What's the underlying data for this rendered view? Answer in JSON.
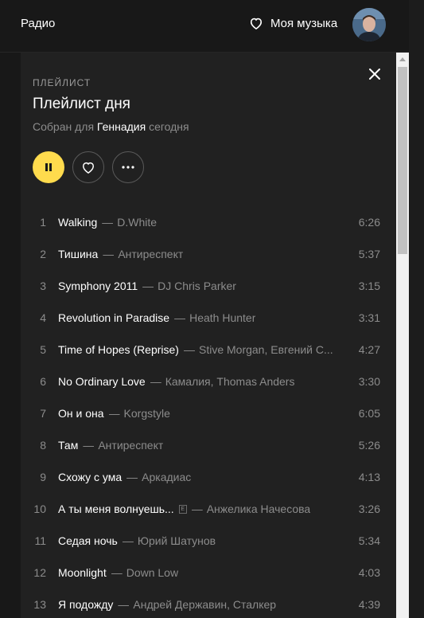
{
  "topbar": {
    "radio_label": "Радио",
    "my_music_label": "Моя музыка"
  },
  "playlist": {
    "kind": "ПЛЕЙЛИСТ",
    "title": "Плейлист дня",
    "subtitle_prefix": "Собран для",
    "subtitle_user": "Геннадия",
    "subtitle_suffix": "сегодня"
  },
  "colors": {
    "accent": "#ffdb4d",
    "background": "#181818",
    "panel": "#212121"
  },
  "controls": {
    "play_icon": "pause-icon",
    "like_icon": "heart-icon",
    "more_icon": "more-icon"
  },
  "tracks": [
    {
      "num": "1",
      "title": "Walking",
      "artist": "D.White",
      "duration": "6:26",
      "explicit": false
    },
    {
      "num": "2",
      "title": "Тишина",
      "artist": "Антиреспект",
      "duration": "5:37",
      "explicit": false
    },
    {
      "num": "3",
      "title": "Symphony 2011",
      "artist": "DJ Chris Parker",
      "duration": "3:15",
      "explicit": false
    },
    {
      "num": "4",
      "title": "Revolution in Paradise",
      "artist": "Heath Hunter",
      "duration": "3:31",
      "explicit": false
    },
    {
      "num": "5",
      "title": "Time of Hopes (Reprise)",
      "artist": "Stive Morgan, Евгений С...",
      "duration": "4:27",
      "explicit": false
    },
    {
      "num": "6",
      "title": "No Ordinary Love",
      "artist": "Камалия, Thomas Anders",
      "duration": "3:30",
      "explicit": false
    },
    {
      "num": "7",
      "title": "Он и она",
      "artist": "Korgstyle",
      "duration": "6:05",
      "explicit": false
    },
    {
      "num": "8",
      "title": "Там",
      "artist": "Антиреспект",
      "duration": "5:26",
      "explicit": false
    },
    {
      "num": "9",
      "title": "Схожу с ума",
      "artist": "Аркадиас",
      "duration": "4:13",
      "explicit": false
    },
    {
      "num": "10",
      "title": "А ты меня волнуешь...",
      "artist": "Анжелика Начесова",
      "duration": "3:26",
      "explicit": true,
      "explicit_mark": "E"
    },
    {
      "num": "11",
      "title": "Седая ночь",
      "artist": "Юрий Шатунов",
      "duration": "5:34",
      "explicit": false
    },
    {
      "num": "12",
      "title": "Moonlight",
      "artist": "Down Low",
      "duration": "4:03",
      "explicit": false
    },
    {
      "num": "13",
      "title": "Я подожду",
      "artist": "Андрей Державин, Сталкер",
      "duration": "4:39",
      "explicit": false
    }
  ]
}
